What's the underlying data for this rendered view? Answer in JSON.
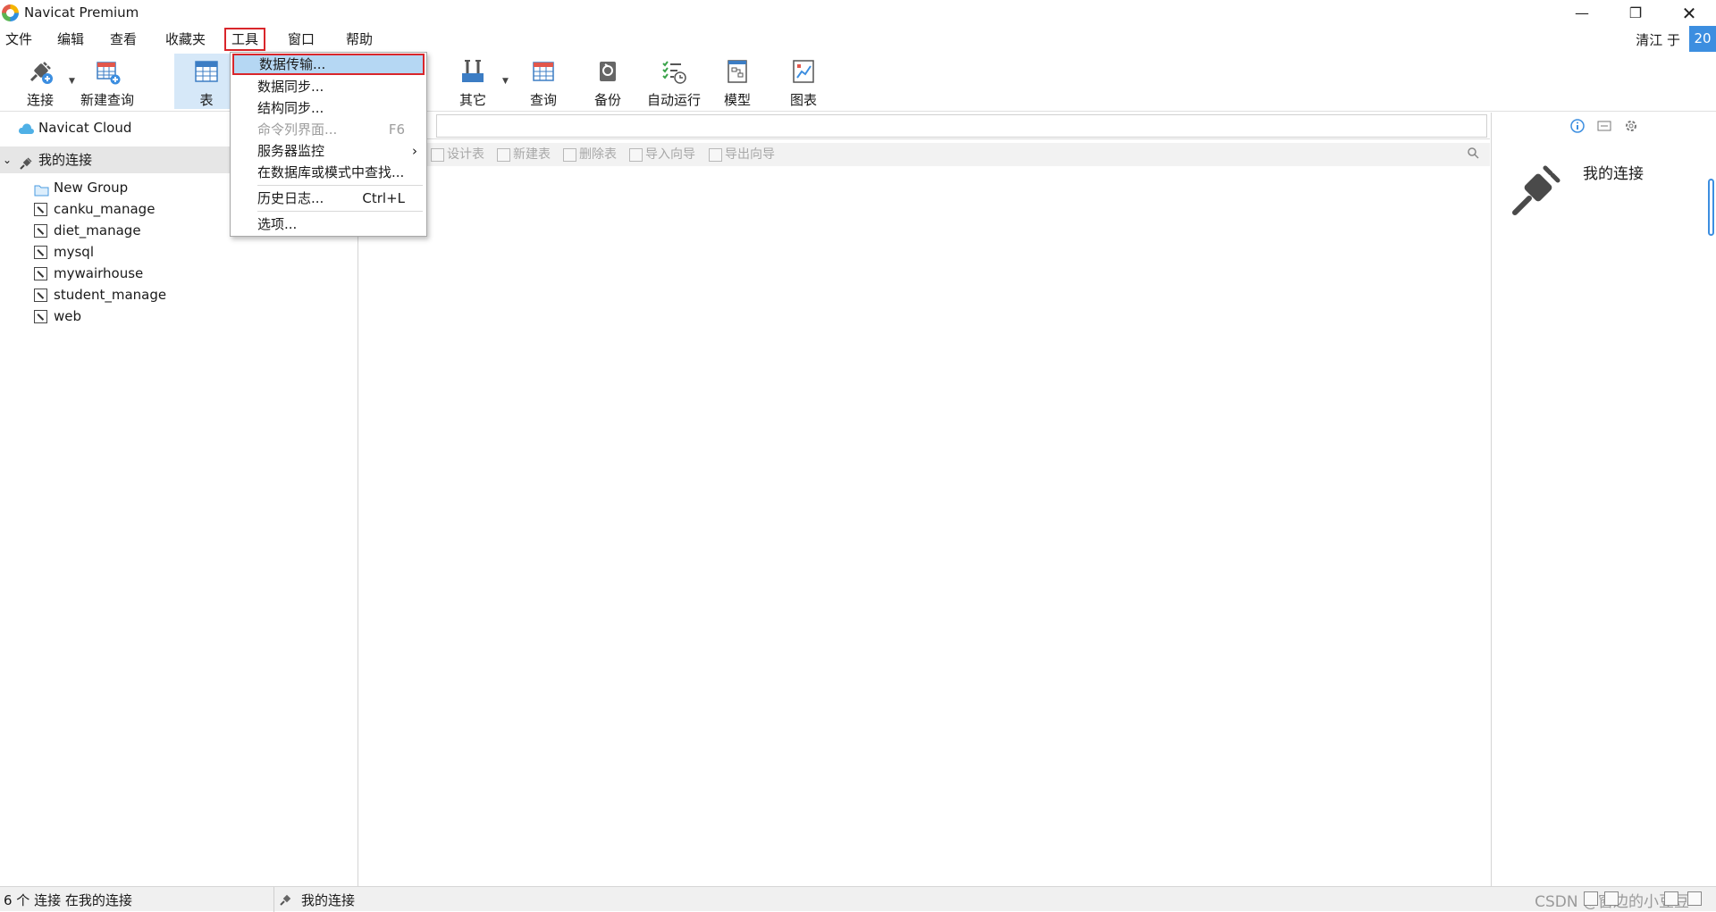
{
  "window": {
    "title": "Navicat Premium",
    "controls": [
      "minimize-icon",
      "restore-icon",
      "close-icon"
    ]
  },
  "menubar": {
    "items": [
      "文件",
      "编辑",
      "查看",
      "收藏夹",
      "工具",
      "窗口",
      "帮助"
    ],
    "user_name": "清江 于",
    "user_badge": "20"
  },
  "toolbar": {
    "buttons": [
      {
        "label": "连接",
        "icon": "plug-icon"
      },
      {
        "label": "新建查询",
        "icon": "new-query-icon"
      },
      {
        "label": "表",
        "icon": "table-icon"
      },
      {
        "label": "其它",
        "icon": "tools-icon"
      },
      {
        "label": "查询",
        "icon": "query-icon"
      },
      {
        "label": "备份",
        "icon": "backup-icon"
      },
      {
        "label": "自动运行",
        "icon": "schedule-icon"
      },
      {
        "label": "模型",
        "icon": "model-icon"
      },
      {
        "label": "图表",
        "icon": "chart-icon"
      }
    ]
  },
  "tools_menu": {
    "items": [
      {
        "label": "数据传输...",
        "shortcut": "",
        "highlighted": true
      },
      {
        "label": "数据同步...",
        "shortcut": ""
      },
      {
        "label": "结构同步...",
        "shortcut": ""
      },
      {
        "label": "命令列界面...",
        "shortcut": "F6",
        "disabled": true
      },
      {
        "label": "服务器监控",
        "shortcut": "",
        "submenu": true
      },
      {
        "label": "在数据库或模式中查找...",
        "shortcut": ""
      },
      {
        "label": "历史日志...",
        "shortcut": "Ctrl+L"
      },
      {
        "label": "选项...",
        "shortcut": ""
      }
    ]
  },
  "navigator": {
    "cloud_label": "Navicat Cloud",
    "my_connections_label": "我的连接",
    "items": [
      "New Group",
      "canku_manage",
      "diet_manage",
      "mysql",
      "mywairhouse",
      "student_manage",
      "web"
    ]
  },
  "object_toolbar": {
    "buttons": [
      "设计表",
      "新建表",
      "删除表",
      "导入向导",
      "导出向导"
    ]
  },
  "info_pane": {
    "title": "我的连接"
  },
  "statusbar": {
    "left_text": "6 个 连接 在我的连接",
    "connection_text": "我的连接",
    "watermark": "CSDN @窗边的小豆豆"
  },
  "colors": {
    "accent": "#3c8ee0",
    "highlight_border": "#d9262b",
    "menu_selection": "#b5d7f3"
  }
}
